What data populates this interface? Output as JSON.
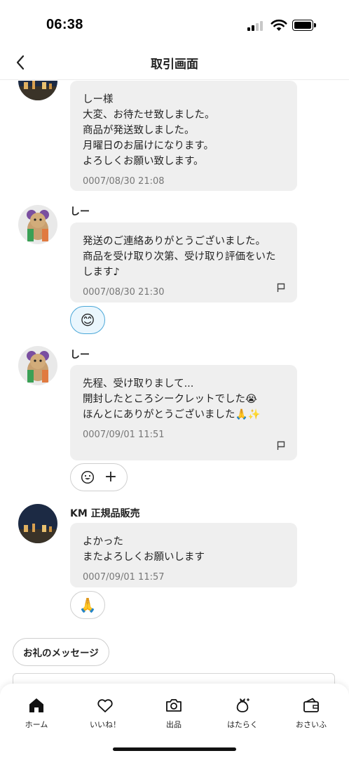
{
  "status_bar": {
    "time": "06:38"
  },
  "header": {
    "title": "取引画面"
  },
  "messages": [
    {
      "text": "しー様\n大変、お待たせ致しました。\n商品が発送致しました。\n月曜日のお届けになります。\nよろしくお願い致します。",
      "time": "0007/08/30 21:08"
    },
    {
      "sender": "しー",
      "text": "発送のご連絡ありがとうございました。\n商品を受け取り次第、受け取り評価をいたします♪",
      "time": "0007/08/30 21:30",
      "reaction": "😊"
    },
    {
      "sender": "しー",
      "text": "先程、受け取りまして...\n開封したところシークレットでした😭\nほんとにありがとうございました🙏✨",
      "time": "0007/09/01 11:51",
      "add_reaction_label": "+"
    },
    {
      "sender": "KM 正規品販売",
      "text": "よかった\nまたよろしくお願いします",
      "time": "0007/09/01 11:57",
      "reaction": "🙏"
    }
  ],
  "thanks_button": {
    "label": "お礼のメッセージ"
  },
  "bottom_nav": {
    "items": [
      {
        "label": "ホーム",
        "icon": "home-icon"
      },
      {
        "label": "いいね！",
        "icon": "heart-icon"
      },
      {
        "label": "出品",
        "icon": "camera-icon"
      },
      {
        "label": "はたらく",
        "icon": "money-bag-icon"
      },
      {
        "label": "おさいふ",
        "icon": "wallet-icon"
      }
    ]
  },
  "colors": {
    "bubble": "#efefef",
    "reaction_selected_border": "#4aa7d8",
    "reaction_selected_bg": "#eaf6fd",
    "timestamp": "#777777"
  }
}
